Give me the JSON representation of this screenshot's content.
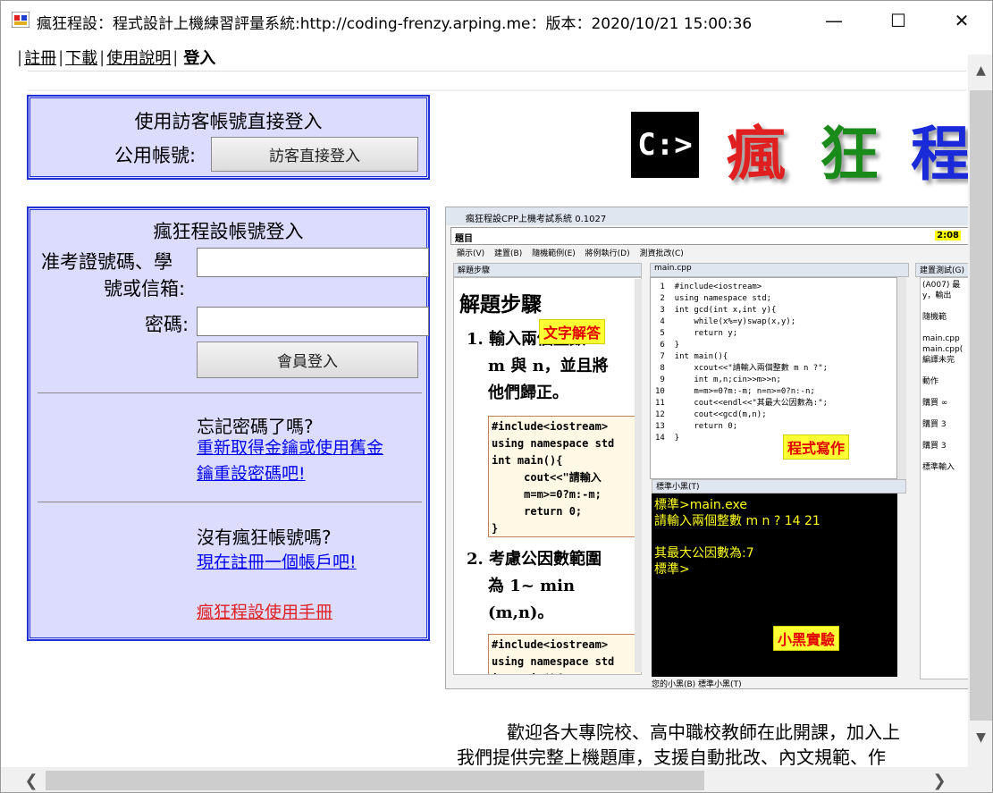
{
  "window": {
    "title": "瘋狂程設：程式設計上機練習評量系統:http://coding-frenzy.arping.me：版本：2020/10/21 15:00:36",
    "minimize": "—",
    "maximize": "☐",
    "close": "✕"
  },
  "menu": {
    "items": [
      "註冊",
      "下載",
      "使用說明"
    ],
    "active": "登入"
  },
  "guest_panel": {
    "title": "使用訪客帳號直接登入",
    "account_label": "公用帳號:",
    "login_button": "訪客直接登入"
  },
  "member_panel": {
    "title": "瘋狂程設帳號登入",
    "id_label_line1": "准考證號碼、學",
    "id_label_line2": "號或信箱:",
    "id_value": "",
    "password_label": "密碼:",
    "password_value": "",
    "login_button": "會員登入",
    "forgot_prompt": "忘記密碼了嗎?",
    "forgot_link_line1": "重新取得金鑰或使用舊金",
    "forgot_link_line2": "鑰重設密碼吧!",
    "no_account_prompt": "沒有瘋狂帳號嗎?",
    "register_link": "現在註冊一個帳戶吧!",
    "manual_link": "瘋狂程設使用手冊"
  },
  "logo": {
    "symbol": "C:>",
    "chars": [
      "瘋",
      "狂",
      "程"
    ],
    "colors": [
      "#e02020",
      "#1a8a1a",
      "#1a2ad8"
    ]
  },
  "preview": {
    "title": "瘋狂程設CPP上機考試系統 0.1027",
    "problem_label": "題目",
    "timer": "2:08",
    "menu": "顯示(V) 建置(B) 隨機範例(E) 將例執行(D) 測資批改(C)",
    "steps_pane": "解題步驟",
    "editor_tab": "main.cpp",
    "right_pane": "建置測試(G)",
    "steps_heading": "解題步驟",
    "step1_line1": "1. 輸入兩個整數",
    "step1_line2": "m 與 n，並且將",
    "step1_line3": "他們歸正。",
    "code1": "#include<iostream>\nusing namespace std\nint main(){\n     cout<<\"請輸入\n     m=m>=0?m:-m;\n     return 0;\n}",
    "step2_line1": "2. 考慮公因數範圍",
    "step2_line2": "為 1~ min",
    "step2_line3": "(m,n)。",
    "code2": "#include<iostream>\nusing namespace std\nint main(){",
    "sticker_text": "文字解答",
    "sticker_code": "程式寫作",
    "sticker_console": "小黑實驗",
    "source": " 1  #include<iostream>\n 2  using namespace std;\n 3  int gcd(int x,int y){\n 4      while(x%=y)swap(x,y);\n 5      return y;\n 6  }\n 7  int main(){\n 8      xcout<<\"請輸入兩個整數 m n ?\";\n 9      int m,n;cin>>m>>n;\n10      m=m>=0?m:-m; n=n>=0?n:-n;\n11      cout<<endl<<\"其最大公因數為:\";\n12      cout<<gcd(m,n);\n13      return 0;\n14  }",
    "console_pane": "標準小黑(T)",
    "console_text": "標準>main.exe\n請輸入兩個整數 m n ? 14 21\n\n其最大公因數為:7\n標準>",
    "right_text": "(A007) 最\ny，輸出\n\n隨機範\n\nmain.cpp\nmain.cpp(\n編譯未完\n\n動作 \n\n購買 ∞\n\n購買 3\n\n購買 3\n\n標準輸入",
    "bottom_tabs": "您的小黑(B)  標準小黑(T)"
  },
  "welcome": {
    "line1": "歡迎各大專院校、高中職校教師在此開課，加入上",
    "line2": "我們提供完整上機題庫，支援自動批改、內文規範、作"
  }
}
